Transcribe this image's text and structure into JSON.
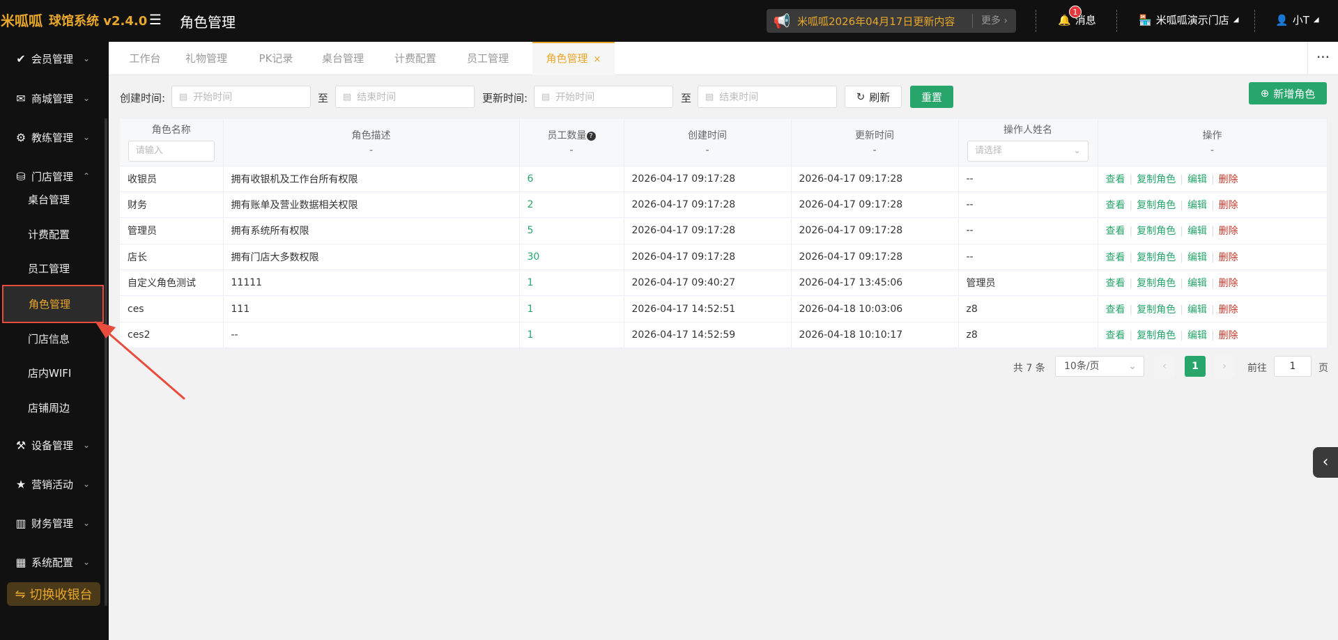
{
  "header": {
    "logo_text": "米呱呱",
    "app_title": "球馆系统 v2.4.0",
    "page_title": "角色管理",
    "notice_text": "米呱呱2026年04月17日更新内容",
    "notice_more": "更多",
    "messages_label": "消息",
    "messages_badge": "1",
    "store_name": "米呱呱演示门店",
    "user_name": "小T"
  },
  "sidebar": {
    "groups": {
      "member": "会员管理",
      "mall": "商城管理",
      "coach": "教练管理",
      "store": "门店管理",
      "device": "设备管理",
      "marketing": "营销活动",
      "finance": "财务管理",
      "system": "系统配置"
    },
    "store_items": [
      "桌台管理",
      "计费配置",
      "员工管理",
      "角色管理",
      "门店信息",
      "店内WIFI",
      "店铺周边"
    ],
    "switch_button": "切换收银台"
  },
  "tabs": [
    "工作台",
    "礼物管理",
    "PK记录",
    "桌台管理",
    "计费配置",
    "员工管理",
    "角色管理"
  ],
  "filters": {
    "created_label": "创建时间:",
    "updated_label": "更新时间:",
    "to_label": "至",
    "start_placeholder": "开始时间",
    "end_placeholder": "结束时间",
    "refresh_button": "刷新",
    "reset_button": "重置",
    "new_button": "新增角色"
  },
  "table": {
    "headers": {
      "name": "角色名称",
      "desc": "角色描述",
      "staff": "员工数量",
      "created": "创建时间",
      "updated": "更新时间",
      "operator": "操作人姓名",
      "actions": "操作",
      "dash": "-"
    },
    "name_placeholder": "请输入",
    "operator_placeholder": "请选择",
    "actions": {
      "view": "查看",
      "copy": "复制角色",
      "edit": "编辑",
      "delete": "删除"
    },
    "rows": [
      {
        "name": "收银员",
        "desc": "拥有收银机及工作台所有权限",
        "staff": "6",
        "created": "2026-04-17 09:17:28",
        "updated": "2026-04-17 09:17:28",
        "operator": "--"
      },
      {
        "name": "财务",
        "desc": "拥有账单及营业数据相关权限",
        "staff": "2",
        "created": "2026-04-17 09:17:28",
        "updated": "2026-04-17 09:17:28",
        "operator": "--"
      },
      {
        "name": "管理员",
        "desc": "拥有系统所有权限",
        "staff": "5",
        "created": "2026-04-17 09:17:28",
        "updated": "2026-04-17 09:17:28",
        "operator": "--"
      },
      {
        "name": "店长",
        "desc": "拥有门店大多数权限",
        "staff": "30",
        "created": "2026-04-17 09:17:28",
        "updated": "2026-04-17 09:17:28",
        "operator": "--"
      },
      {
        "name": "自定义角色测试",
        "desc": "11111",
        "staff": "1",
        "created": "2026-04-17 09:40:27",
        "updated": "2026-04-17 13:45:06",
        "operator": "管理员"
      },
      {
        "name": "ces",
        "desc": "111",
        "staff": "1",
        "created": "2026-04-17 14:52:51",
        "updated": "2026-04-18 10:03:06",
        "operator": "z8"
      },
      {
        "name": "ces2",
        "desc": "--",
        "staff": "1",
        "created": "2026-04-17 14:52:59",
        "updated": "2026-04-18 10:10:17",
        "operator": "z8"
      }
    ]
  },
  "pagination": {
    "total": "共 7 条",
    "page_size": "10条/页",
    "current": "1",
    "goto_label": "前往",
    "goto_value": "1",
    "page_suffix": "页"
  },
  "colors": {
    "accent": "#e9a72b",
    "primary": "#27a56a",
    "danger": "#c0392b",
    "annotation": "#e84c3d"
  }
}
